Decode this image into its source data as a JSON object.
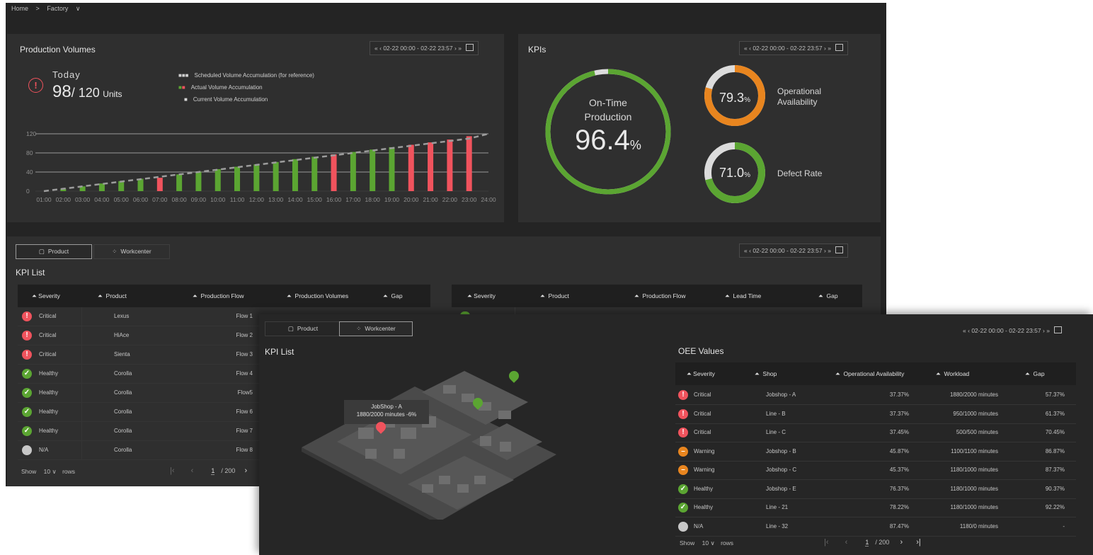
{
  "breadcrumb": {
    "home": "Home",
    "sep": ">",
    "current": "Factory",
    "chevron": "∨"
  },
  "date_range": {
    "first": "«",
    "prev": "‹",
    "range": "02-22 00:00 - 02-22 23:57",
    "next": "›",
    "last": "»"
  },
  "production": {
    "title": "Production Volumes",
    "today_label": "Today",
    "value": "98",
    "target": "/ 120",
    "unit": "Units",
    "legend": [
      "Scheduled Volume Accumulation (for reference)",
      "Actual Volume Accumulation",
      "Current Volume Accumulation"
    ],
    "colors": {
      "green": "#5ba532",
      "red": "#f0535d",
      "alert": "#f0535d"
    }
  },
  "chart_data": {
    "type": "bar",
    "categories": [
      "01:00",
      "02:00",
      "03:00",
      "04:00",
      "05:00",
      "06:00",
      "07:00",
      "08:00",
      "09:00",
      "10:00",
      "11:00",
      "12:00",
      "13:00",
      "14:00",
      "15:00",
      "16:00",
      "17:00",
      "18:00",
      "19:00",
      "20:00",
      "21:00",
      "22:00",
      "23:00",
      "24:00"
    ],
    "series": [
      {
        "values": [
          null,
          5,
          10,
          16,
          21,
          26,
          28,
          35,
          41,
          46,
          51,
          56,
          61,
          67,
          72,
          77,
          82,
          87,
          92,
          97,
          102,
          108,
          115,
          null
        ],
        "status": [
          null,
          "ok",
          "ok",
          "ok",
          "ok",
          "ok",
          "late",
          "ok",
          "ok",
          "ok",
          "ok",
          "ok",
          "ok",
          "ok",
          "ok",
          "late",
          "ok",
          "ok",
          "ok",
          "late",
          "late",
          "late",
          "late",
          null
        ]
      },
      {
        "values": [
          0,
          5,
          10,
          15,
          20,
          25,
          30,
          35,
          40,
          45,
          50,
          55,
          60,
          65,
          70,
          75,
          80,
          85,
          90,
          95,
          100,
          105,
          110,
          120
        ],
        "style": "dashed"
      }
    ],
    "yticks": [
      0,
      40,
      80,
      120
    ],
    "ylim": [
      0,
      130
    ]
  },
  "kpis": {
    "title": "KPIs",
    "ontime": {
      "label1": "On-Time",
      "label2": "Production",
      "value": "96.4",
      "pct": "%",
      "fraction": 0.964
    },
    "availability": {
      "value": "79.3",
      "pct": "%",
      "label1": "Operational",
      "label2": "Availability",
      "fraction": 0.793
    },
    "defect": {
      "value": "71.0",
      "pct": "%",
      "label": "Defect Rate",
      "fraction": 0.71
    },
    "colors": {
      "green": "#5ba532",
      "orange": "#e8851f",
      "track": "#dcdcdc"
    }
  },
  "tabs": {
    "product": "Product",
    "workcenter": "Workcenter"
  },
  "kpi_list": {
    "title": "KPI List",
    "left_headers": [
      "Severity",
      "Product",
      "Production Flow",
      "Production Volumes",
      "Gap"
    ],
    "right_headers": [
      "Severity",
      "Product",
      "Production Flow",
      "Lead Time",
      "Gap"
    ],
    "rows": [
      {
        "severity": "Critical",
        "level": "critical",
        "product": "Lexus",
        "flow": "Flow 1"
      },
      {
        "severity": "Critical",
        "level": "critical",
        "product": "HiAce",
        "flow": "Flow 2"
      },
      {
        "severity": "Critical",
        "level": "critical",
        "product": "Sienta",
        "flow": "Flow 3"
      },
      {
        "severity": "Healthy",
        "level": "healthy",
        "product": "Corolla",
        "flow": "Flow 4"
      },
      {
        "severity": "Healthy",
        "level": "healthy",
        "product": "Corolla",
        "flow": "Flow5"
      },
      {
        "severity": "Healthy",
        "level": "healthy",
        "product": "Corolla",
        "flow": "Flow 6"
      },
      {
        "severity": "Healthy",
        "level": "healthy",
        "product": "Corolla",
        "flow": "Flow 7"
      },
      {
        "severity": "N/A",
        "level": "na",
        "product": "Corolla",
        "flow": "Flow 8"
      }
    ],
    "footer": {
      "show": "Show",
      "count": "10",
      "rows": "rows",
      "page": "1",
      "total": "/ 200"
    }
  },
  "workcenter": {
    "title": "KPI List",
    "tooltip_line1": "JobShop - A",
    "tooltip_line2": "1880/2000 minutes -6%",
    "oee_title": "OEE Values",
    "headers": [
      "Severity",
      "Shop",
      "Operational Availability",
      "Workload",
      "Gap"
    ],
    "rows": [
      {
        "severity": "Critical",
        "level": "critical",
        "shop": "Jobshop - A",
        "avail": "37.37%",
        "workload": "1880/2000 minutes",
        "gap": "57.37%"
      },
      {
        "severity": "Critical",
        "level": "critical",
        "shop": "Line - B",
        "avail": "37.37%",
        "workload": "950/1000 minutes",
        "gap": "61.37%"
      },
      {
        "severity": "Critical",
        "level": "critical",
        "shop": "Line - C",
        "avail": "37.45%",
        "workload": "500/500 minutes",
        "gap": "70.45%"
      },
      {
        "severity": "Warning",
        "level": "warning",
        "shop": "Jobshop - B",
        "avail": "45.87%",
        "workload": "1100/1100 minutes",
        "gap": "86.87%"
      },
      {
        "severity": "Warning",
        "level": "warning",
        "shop": "Jobshop - C",
        "avail": "45.37%",
        "workload": "1180/1000 minutes",
        "gap": "87.37%"
      },
      {
        "severity": "Healthy",
        "level": "healthy",
        "shop": "Jobshop - E",
        "avail": "76.37%",
        "workload": "1180/1000 minutes",
        "gap": "90.37%"
      },
      {
        "severity": "Healthy",
        "level": "healthy",
        "shop": "Line - 21",
        "avail": "78.22%",
        "workload": "1180/1000 minutes",
        "gap": "92.22%"
      },
      {
        "severity": "N/A",
        "level": "na",
        "shop": "Line - 32",
        "avail": "87.47%",
        "workload": "1180/0 minutes",
        "gap": "-"
      }
    ],
    "footer": {
      "show": "Show",
      "count": "10",
      "rows": "rows",
      "page": "1",
      "total": "/ 200"
    }
  }
}
